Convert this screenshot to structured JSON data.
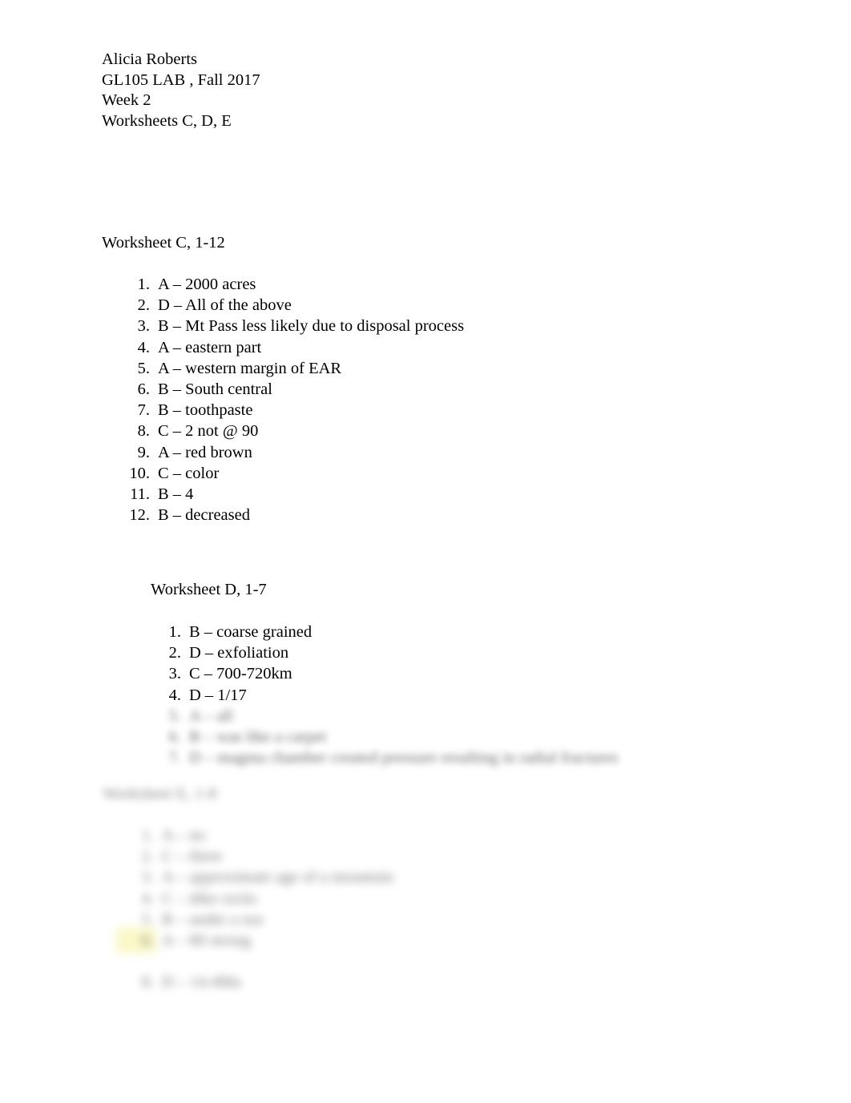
{
  "document": {
    "background_color": "#ffffff",
    "text_color": "#000000",
    "highlight_color": "#f6f39a"
  },
  "header": {
    "line1": "Alicia Roberts",
    "line2": "GL105 LAB , Fall 2017",
    "line3": "Week 2",
    "line4": "Worksheets C, D, E"
  },
  "sections": [
    {
      "id": "worksheet-c",
      "heading": "Worksheet C, 1-12",
      "items": [
        {
          "num": "1.",
          "text": "A – 2000 acres",
          "blurred": false,
          "highlighted": false
        },
        {
          "num": "2.",
          "text": "D – All of the above",
          "blurred": false,
          "highlighted": false
        },
        {
          "num": "3.",
          "text": "B – Mt Pass less likely due to disposal process",
          "blurred": false,
          "highlighted": false
        },
        {
          "num": "4.",
          "text": "A – eastern part",
          "blurred": false,
          "highlighted": false
        },
        {
          "num": "5.",
          "text": "A – western margin of EAR",
          "blurred": false,
          "highlighted": false
        },
        {
          "num": "6.",
          "text": "B – South central",
          "blurred": false,
          "highlighted": false
        },
        {
          "num": "7.",
          "text": "B – toothpaste",
          "blurred": false,
          "highlighted": false
        },
        {
          "num": "8.",
          "text": "C – 2 not @ 90",
          "blurred": false,
          "highlighted": false
        },
        {
          "num": "9.",
          "text": "A – red brown",
          "blurred": false,
          "highlighted": false
        },
        {
          "num": "10.",
          "text": "C – color",
          "blurred": false,
          "highlighted": false
        },
        {
          "num": "11.",
          "text": "B – 4",
          "blurred": false,
          "highlighted": false
        },
        {
          "num": "12.",
          "text": "B – decreased",
          "blurred": false,
          "highlighted": false
        }
      ]
    },
    {
      "id": "worksheet-d",
      "heading": "Worksheet D, 1-7",
      "items": [
        {
          "num": "1.",
          "text": "B – coarse grained",
          "blurred": false,
          "highlighted": false
        },
        {
          "num": "2.",
          "text": "D – exfoliation",
          "blurred": false,
          "highlighted": false
        },
        {
          "num": "3.",
          "text": "C – 700-720km",
          "blurred": false,
          "highlighted": false
        },
        {
          "num": "4.",
          "text": "D – 1/17",
          "blurred": false,
          "highlighted": false
        },
        {
          "num": "5.",
          "text": "A – all",
          "blurred": true,
          "highlighted": false
        },
        {
          "num": "6.",
          "text": "B – was like a carpet",
          "blurred": true,
          "highlighted": false
        },
        {
          "num": "7.",
          "text": "D – magma chamber created pressure resulting in radial fractures",
          "blurred": true,
          "highlighted": false
        }
      ]
    },
    {
      "id": "worksheet-e",
      "heading": "Worksheet E, 1-8",
      "items": [
        {
          "num": "1.",
          "text": "A – no",
          "blurred": true,
          "highlighted": false
        },
        {
          "num": "2.",
          "text": "C – three",
          "blurred": true,
          "highlighted": false
        },
        {
          "num": "3.",
          "text": "A – approximate age of a mountain",
          "blurred": true,
          "highlighted": false
        },
        {
          "num": "4.",
          "text": "C – dike rocks",
          "blurred": true,
          "highlighted": false
        },
        {
          "num": "5.",
          "text": "B – under a sea",
          "blurred": true,
          "highlighted": false
        },
        {
          "num": "6.",
          "text": "A – 80 strong",
          "blurred": true,
          "highlighted": true
        },
        {
          "num": "8.",
          "text": "D – 14.4Ma",
          "blurred": true,
          "highlighted": false
        }
      ]
    }
  ]
}
